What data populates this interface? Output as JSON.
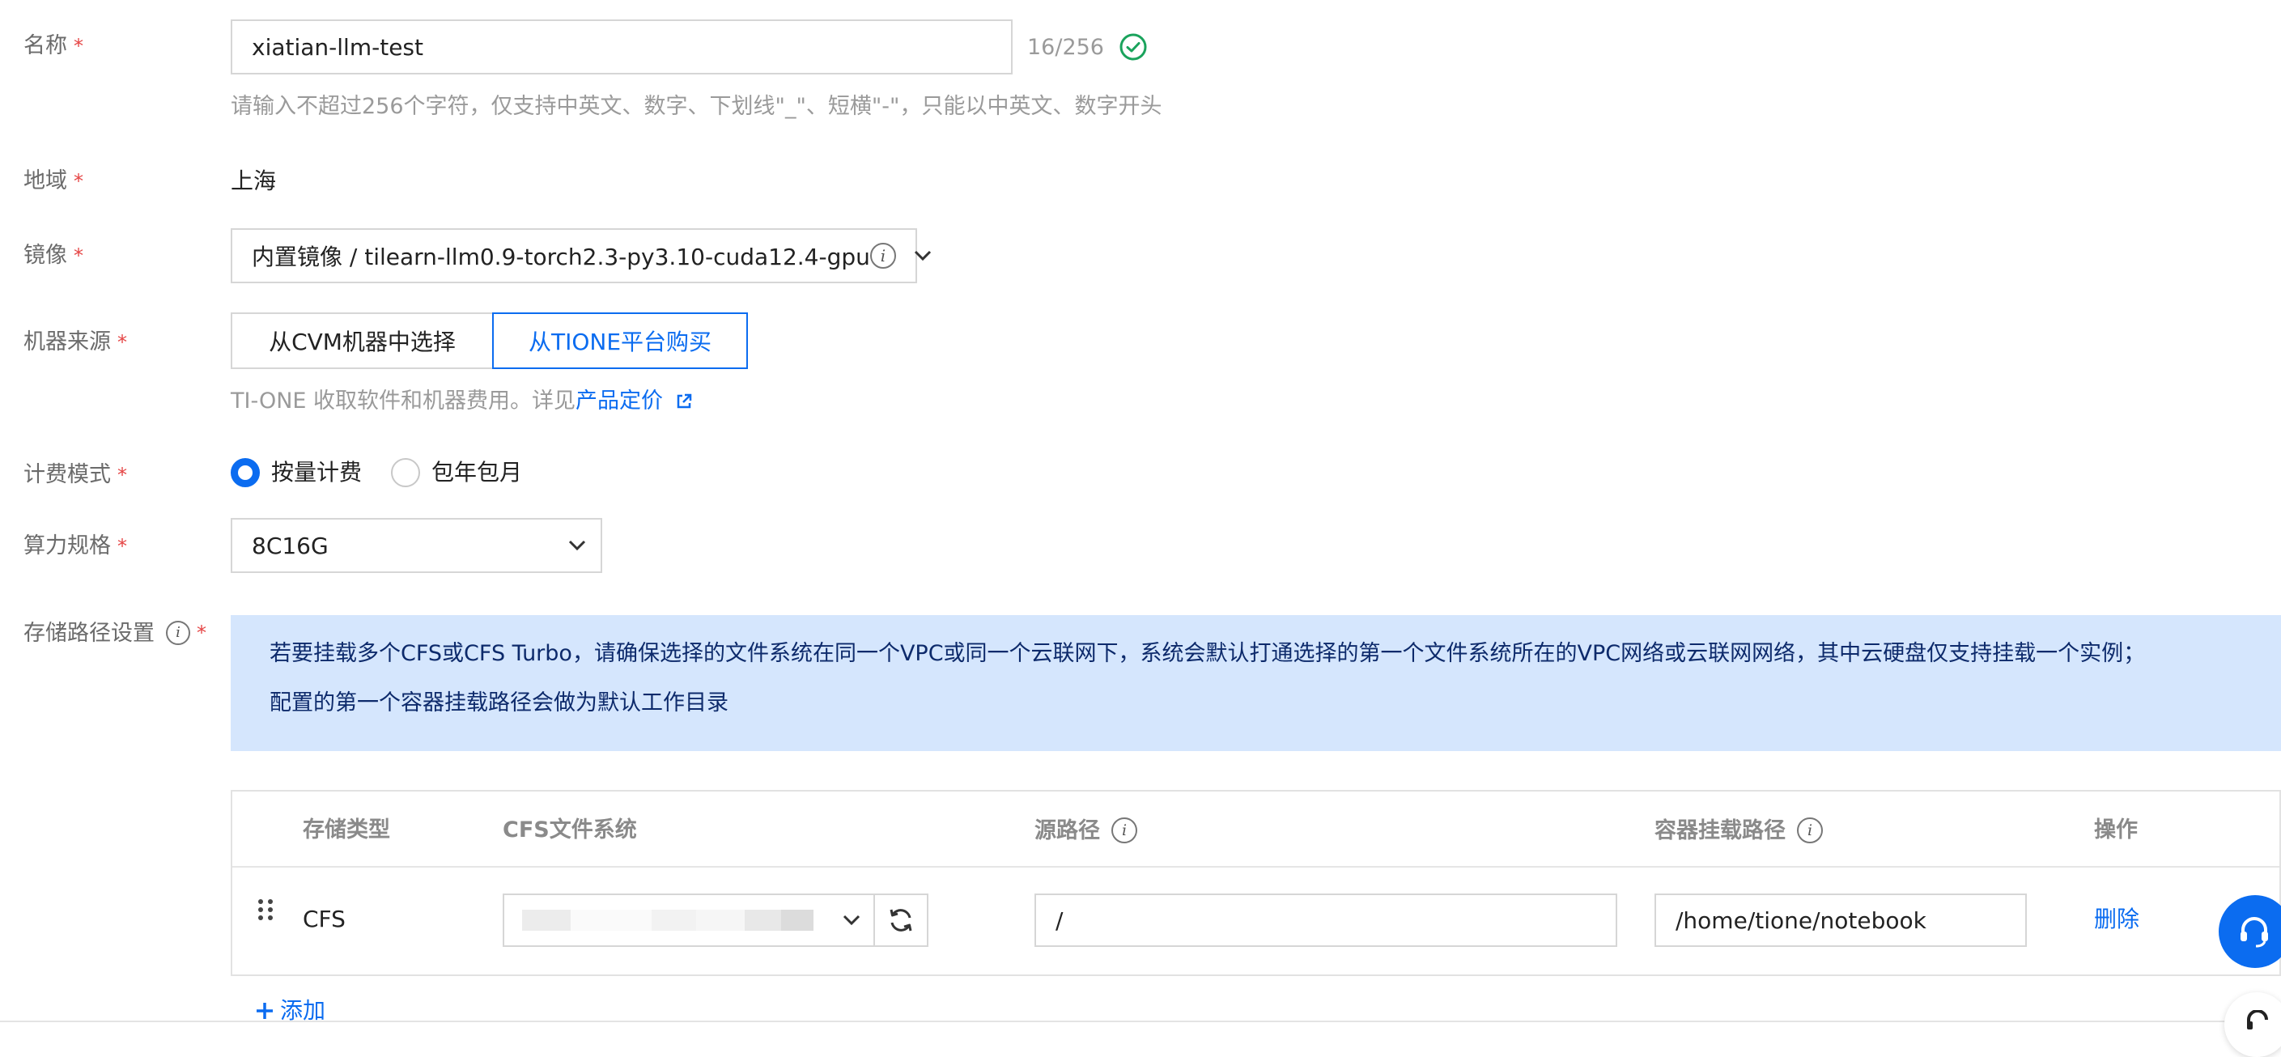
{
  "form": {
    "name": {
      "label": "名称",
      "required_mark": "*",
      "value": "xiatian-llm-test",
      "count": "16/256",
      "hint": "请输入不超过256个字符，仅支持中英文、数字、下划线\"_\"、短横\"-\"，只能以中英文、数字开头"
    },
    "region": {
      "label": "地域",
      "required_mark": "*",
      "value": "上海"
    },
    "image": {
      "label": "镜像",
      "required_mark": "*",
      "value": "内置镜像 / tilearn-llm0.9-torch2.3-py3.10-cuda12.4-gpu"
    },
    "machine_source": {
      "label": "机器来源",
      "required_mark": "*",
      "options": [
        "从CVM机器中选择",
        "从TIONE平台购买"
      ],
      "selected": "从TIONE平台购买",
      "hint_prefix": "TI-ONE 收取软件和机器费用。详见",
      "hint_link": "产品定价"
    },
    "billing": {
      "label": "计费模式",
      "required_mark": "*",
      "options": [
        "按量计费",
        "包年包月"
      ],
      "selected": "按量计费"
    },
    "spec": {
      "label": "算力规格",
      "required_mark": "*",
      "value": "8C16G"
    },
    "storage": {
      "label": "存储路径设置",
      "required_mark": "*",
      "notice_line1": "若要挂载多个CFS或CFS Turbo，请确保选择的文件系统在同一个VPC或同一个云联网下，系统会默认打通选择的第一个文件系统所在的VPC网络或云联网网络，其中云硬盘仅支持挂载一个实例；",
      "notice_line2": "配置的第一个容器挂载路径会做为默认工作目录",
      "table": {
        "headers": {
          "type": "存储类型",
          "cfs": "CFS文件系统",
          "source": "源路径",
          "mount": "容器挂载路径",
          "action": "操作"
        },
        "rows": [
          {
            "type": "CFS",
            "source_path": "/",
            "mount_path": "/home/tione/notebook",
            "action": "删除"
          }
        ]
      },
      "add_label": "添加"
    }
  },
  "colors": {
    "accent": "#0b6cf0",
    "required": "#e54545",
    "notice_bg": "#d5e6fd",
    "success": "#1aa35c"
  },
  "icons": [
    "check-circle-icon",
    "chevron-down-icon",
    "info-icon",
    "external-link-icon",
    "refresh-icon",
    "drag-handle-icon",
    "plus-icon",
    "headset-icon"
  ]
}
